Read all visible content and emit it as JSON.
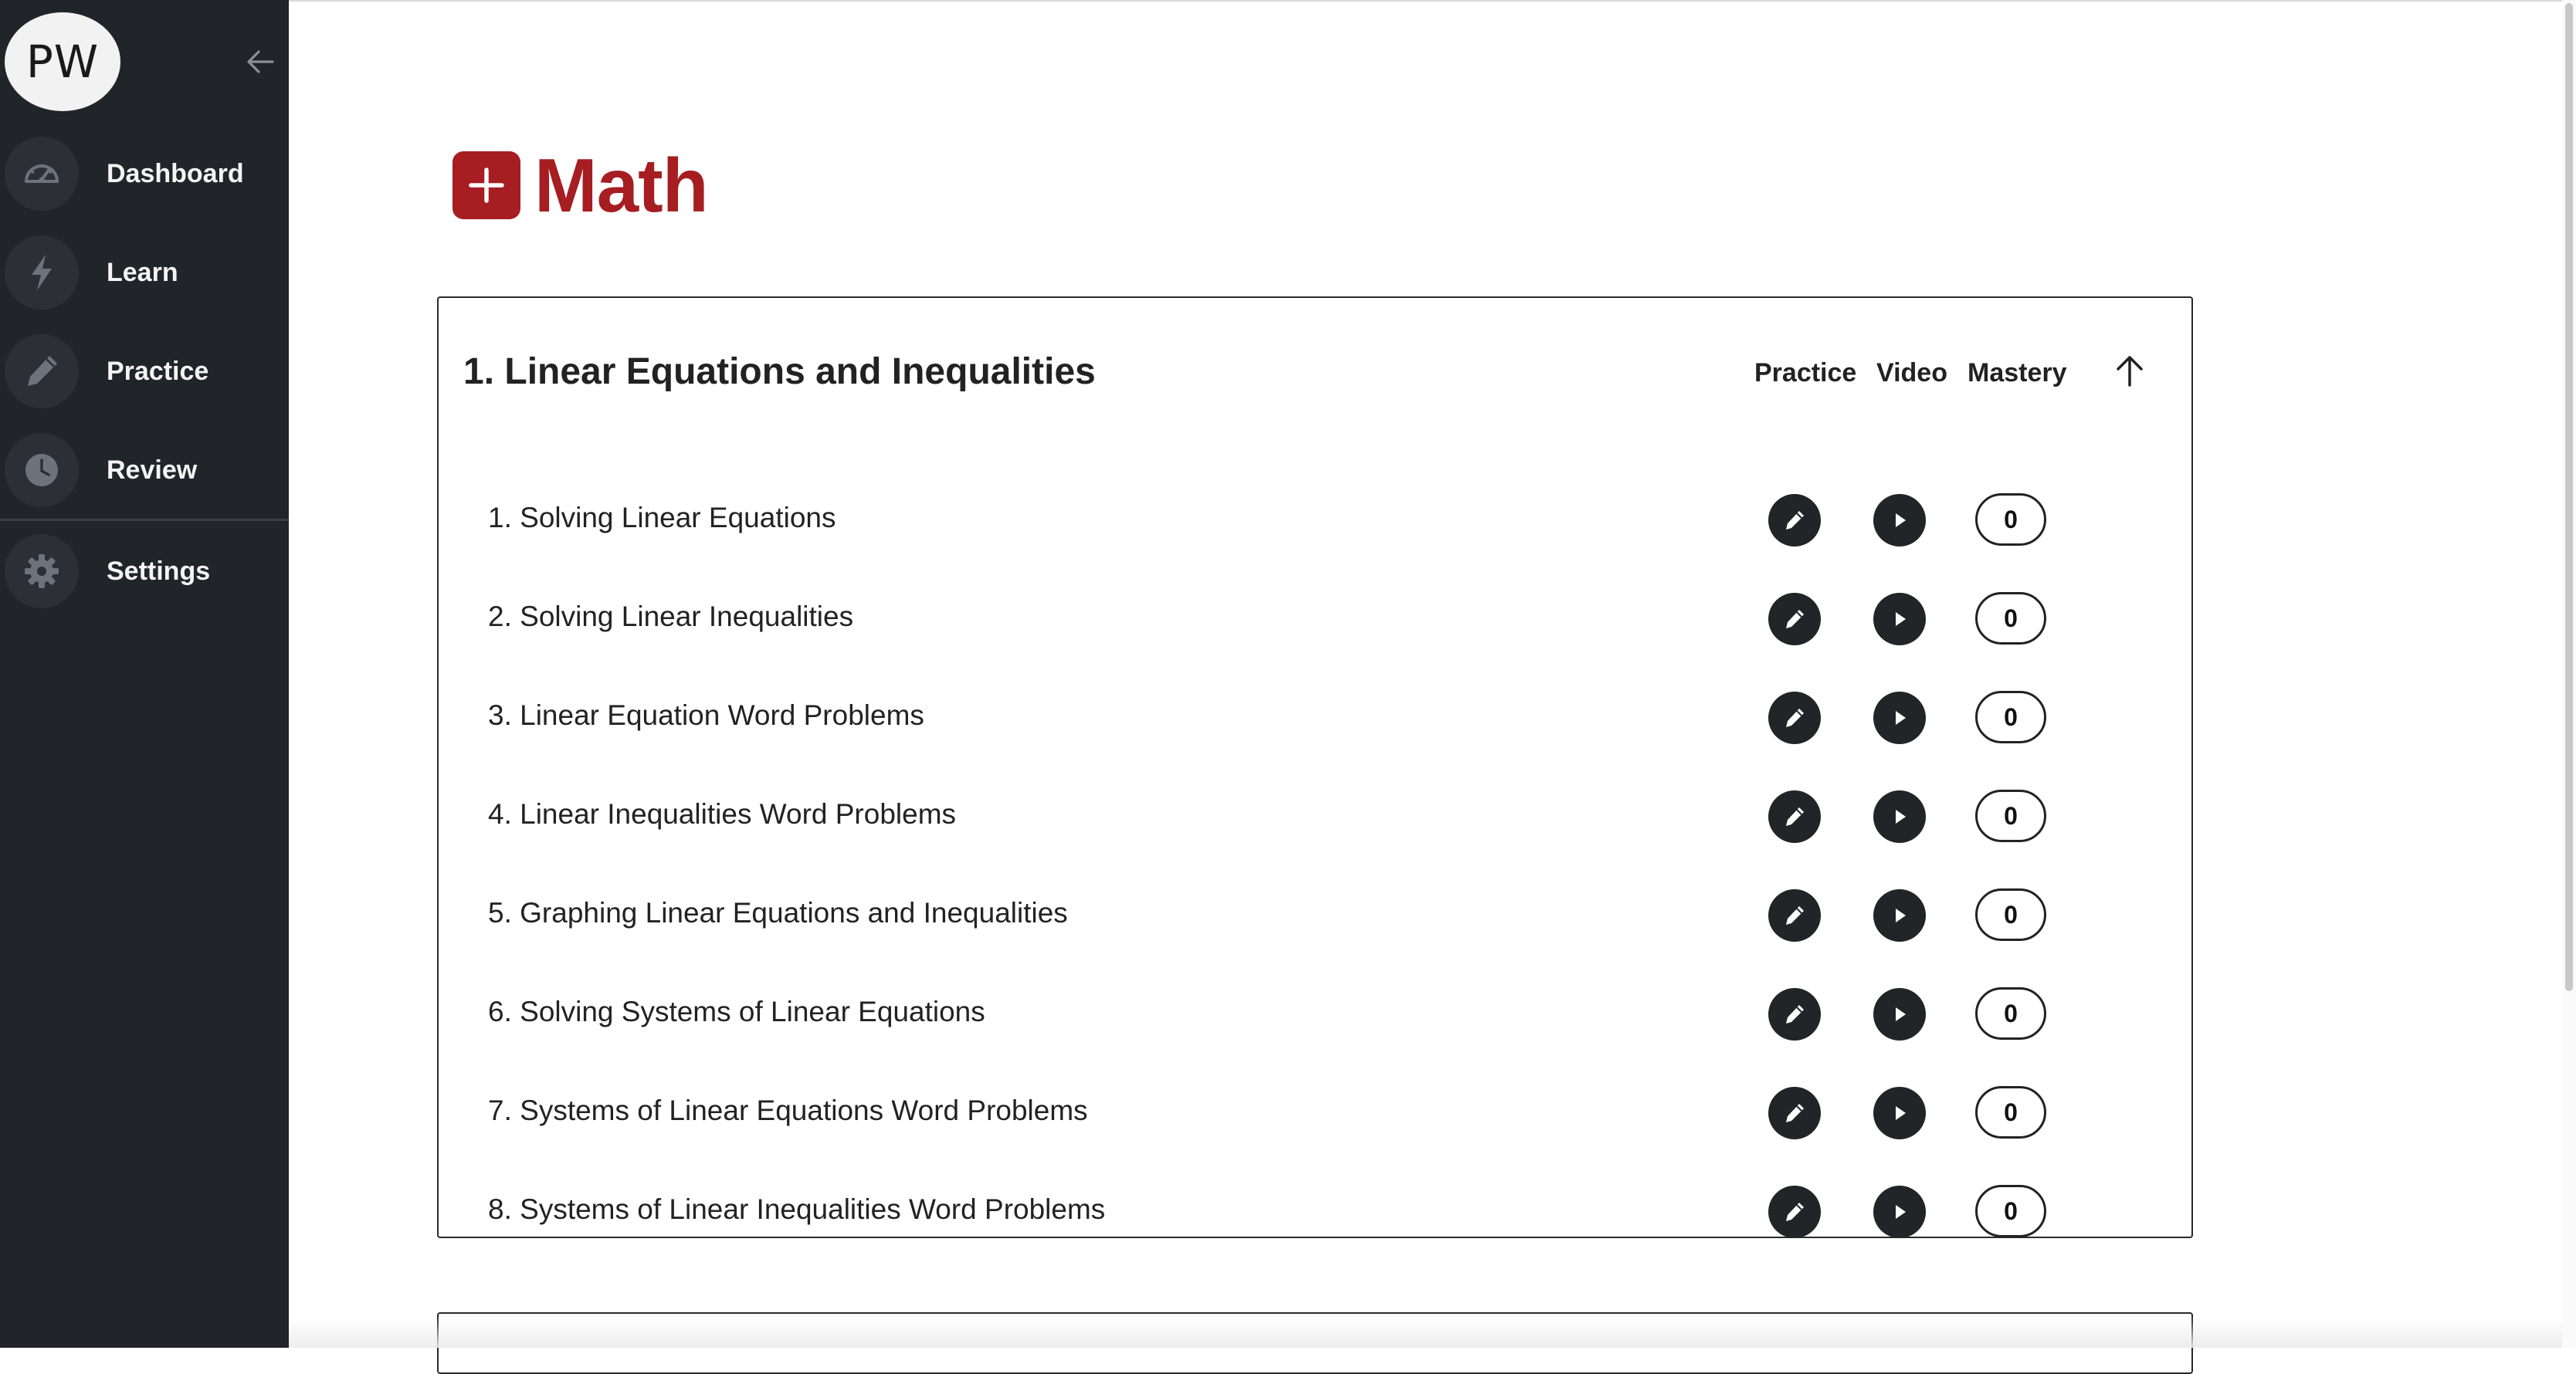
{
  "sidebar": {
    "avatar_initials": "PW",
    "collapse_icon": "arrow-left-icon",
    "items": [
      {
        "label": "Dashboard",
        "icon": "speedometer-icon"
      },
      {
        "label": "Learn",
        "icon": "lightning-icon"
      },
      {
        "label": "Practice",
        "icon": "pencil-icon"
      },
      {
        "label": "Review",
        "icon": "clock-icon"
      },
      {
        "label": "Settings",
        "icon": "gear-icon"
      }
    ]
  },
  "page": {
    "title": "Math",
    "title_icon": "plus-square-icon",
    "accent_color": "#a61d22"
  },
  "unit": {
    "title": "1. Linear Equations and Inequalities",
    "columns": {
      "practice": "Practice",
      "video": "Video",
      "mastery": "Mastery"
    },
    "sort_icon": "arrow-up-icon",
    "lessons": [
      {
        "name": "1. Solving Linear Equations",
        "mastery": "0"
      },
      {
        "name": "2. Solving Linear Inequalities",
        "mastery": "0"
      },
      {
        "name": "3. Linear Equation Word Problems",
        "mastery": "0"
      },
      {
        "name": "4. Linear Inequalities Word Problems",
        "mastery": "0"
      },
      {
        "name": "5. Graphing Linear Equations and Inequalities",
        "mastery": "0"
      },
      {
        "name": "6. Solving Systems of Linear Equations",
        "mastery": "0"
      },
      {
        "name": "7. Systems of Linear Equations Word Problems",
        "mastery": "0"
      },
      {
        "name": "8. Systems of Linear Inequalities Word Problems",
        "mastery": "0"
      }
    ]
  }
}
